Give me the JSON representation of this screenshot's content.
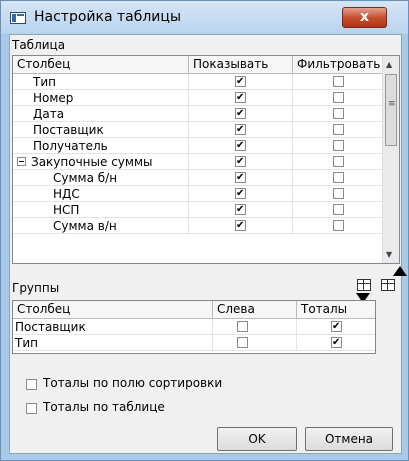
{
  "window": {
    "title": "Настройка таблицы",
    "close": "x"
  },
  "table_section": {
    "label": "Таблица",
    "columns": [
      "Столбец",
      "Показывать",
      "Фильтровать"
    ],
    "rows": [
      {
        "name": "Тип",
        "show": true,
        "filter": false
      },
      {
        "name": "Номер",
        "show": true,
        "filter": false
      },
      {
        "name": "Дата",
        "show": true,
        "filter": false
      },
      {
        "name": "Поставщик",
        "show": true,
        "filter": false
      },
      {
        "name": "Получатель",
        "show": true,
        "filter": false
      },
      {
        "name": "Закупочные суммы",
        "show": true,
        "filter": false
      },
      {
        "name": "Сумма б/н",
        "show": true,
        "filter": false
      },
      {
        "name": "НДС",
        "show": true,
        "filter": false
      },
      {
        "name": "НСП",
        "show": true,
        "filter": false
      },
      {
        "name": "Сумма в/н",
        "show": true,
        "filter": false
      }
    ]
  },
  "groups_section": {
    "label": "Группы",
    "columns": [
      "Столбец",
      "Слева",
      "Тоталы"
    ],
    "rows": [
      {
        "name": "Поставщик",
        "left": false,
        "totals": true
      },
      {
        "name": "Тип",
        "left": false,
        "totals": true
      }
    ]
  },
  "options": {
    "totals_by_sort": "Тоталы по полю сортировки",
    "totals_by_table": "Тоталы по таблице"
  },
  "buttons": {
    "ok": "OK",
    "cancel": "Отмена"
  },
  "icons": {
    "add_group": "table-add-icon",
    "remove_group": "table-remove-icon"
  }
}
